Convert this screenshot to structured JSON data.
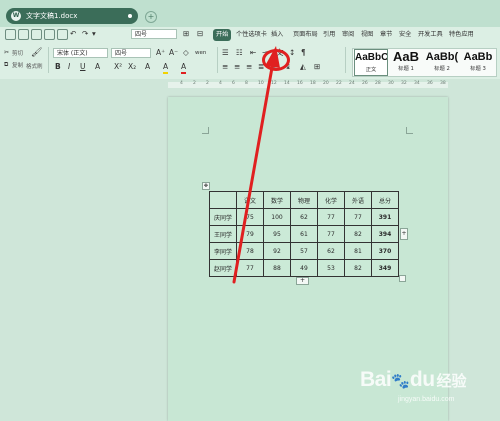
{
  "window": {
    "tab_title": "文字文稿1.docx",
    "tab_icon": "W"
  },
  "menu": {
    "items": [
      {
        "label": "开始",
        "active": true
      },
      {
        "label": "个性选项卡",
        "active": false
      },
      {
        "label": "插入",
        "active": false
      },
      {
        "label": "页面布局",
        "active": false
      },
      {
        "label": "引用",
        "active": false
      },
      {
        "label": "审阅",
        "active": false
      },
      {
        "label": "视图",
        "active": false
      },
      {
        "label": "章节",
        "active": false
      },
      {
        "label": "安全",
        "active": false
      },
      {
        "label": "开发工具",
        "active": false
      },
      {
        "label": "特色应用",
        "active": false
      }
    ]
  },
  "quick_access": {
    "font_size_top": "四号"
  },
  "ribbon": {
    "cut_label": "剪切",
    "copy_label": "复制",
    "format_painter_label": "格式刷",
    "font_name": "宋体 (正文)",
    "font_size": "四号",
    "format_buttons": [
      "B",
      "I",
      "U",
      "A",
      "X²",
      "X₂",
      "A",
      "A",
      "A"
    ],
    "size_buttons": [
      "A⁺",
      "A⁻",
      "◇",
      "wen"
    ]
  },
  "styles": [
    {
      "sample": "AaBbC",
      "name": "正文"
    },
    {
      "sample": "AaB",
      "name": "标题 1"
    },
    {
      "sample": "AaBb(",
      "name": "标题 2"
    },
    {
      "sample": "AaBb",
      "name": "标题 3"
    }
  ],
  "ruler": {
    "numbers": [
      "4",
      "2",
      "2",
      "4",
      "6",
      "8",
      "10",
      "12",
      "14",
      "16",
      "18",
      "20",
      "22",
      "24",
      "26",
      "28",
      "30",
      "32",
      "34",
      "36",
      "38"
    ]
  },
  "table": {
    "header": [
      "",
      "语文",
      "数学",
      "物理",
      "化学",
      "外语",
      "总分"
    ],
    "rows": [
      [
        "庆同学",
        "75",
        "100",
        "62",
        "77",
        "77",
        "391"
      ],
      [
        "王同学",
        "79",
        "95",
        "61",
        "77",
        "82",
        "394"
      ],
      [
        "李同学",
        "78",
        "92",
        "57",
        "62",
        "81",
        "370"
      ],
      [
        "赵同学",
        "77",
        "88",
        "49",
        "53",
        "82",
        "349"
      ]
    ]
  },
  "annotation": {
    "color": "#e02020"
  },
  "watermark": {
    "brand": "Bai",
    "brand_tail": "du",
    "cn": "经验",
    "url": "jingyan.baidu.com"
  }
}
